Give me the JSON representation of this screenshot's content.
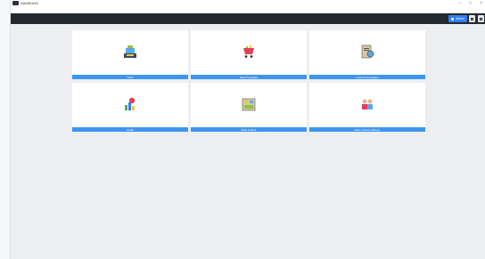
{
  "window": {
    "title": "SAMSUNG",
    "controls": [
      "–",
      "□",
      "×"
    ]
  },
  "header": {
    "user_button_label": "Admin"
  },
  "tiles": [
    {
      "label": "Kasir",
      "icon": "cashier-register-icon"
    },
    {
      "label": "Data Penjualan",
      "icon": "shopping-cart-icon"
    },
    {
      "label": "Laporan Penjualan",
      "icon": "sales-report-icon"
    },
    {
      "label": "Grafik",
      "icon": "chart-analytics-icon"
    },
    {
      "label": "Data Produk",
      "icon": "product-shelf-icon"
    },
    {
      "label": "Data Customer/Buyer",
      "icon": "customers-icon"
    }
  ],
  "colors": {
    "topbar": "#24292e",
    "accent": "#3d95f1",
    "user_button": "#2f7df6",
    "background": "#eceef1"
  }
}
